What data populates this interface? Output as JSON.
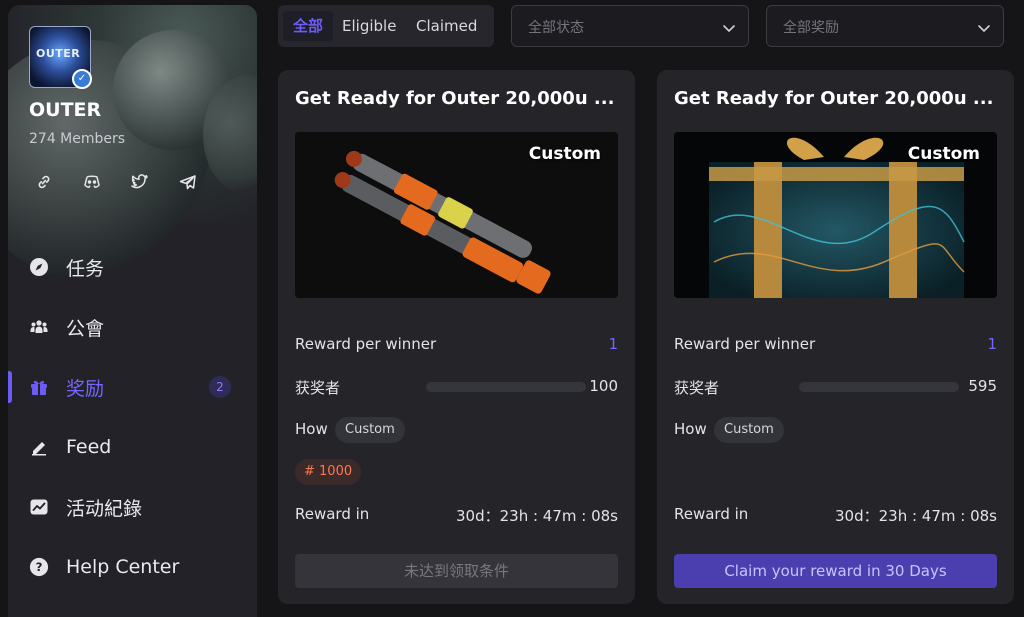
{
  "sidebar": {
    "brand": "OUTER",
    "logo_text": "OUTER",
    "members": "274 Members",
    "socials": [
      "link-icon",
      "discord-icon",
      "twitter-icon",
      "telegram-icon"
    ],
    "nav": [
      {
        "label": "任务",
        "icon": "compass-icon"
      },
      {
        "label": "公會",
        "icon": "community-icon"
      },
      {
        "label": "奖励",
        "icon": "gift-icon",
        "active": true,
        "badge": "2"
      },
      {
        "label": "Feed",
        "icon": "feed-icon"
      },
      {
        "label": "活动紀錄",
        "icon": "activity-chart-icon"
      },
      {
        "label": "Help Center",
        "icon": "help-icon"
      }
    ]
  },
  "filters": {
    "tabs": [
      "全部",
      "Eligible",
      "Claimed"
    ],
    "active_tab": "全部",
    "status_placeholder": "全部状态",
    "reward_placeholder": "全部奖励"
  },
  "cards": [
    {
      "title": "Get Ready for Outer 20,000u ...",
      "banner_tag": "Custom",
      "reward_per_winner_label": "Reward per winner",
      "reward_per_winner": "1",
      "winners_label": "获奖者",
      "winners": "100",
      "winners_progress": 0,
      "how_label": "How",
      "how_chip": "Custom",
      "points": "# 1000",
      "reward_in_label": "Reward in",
      "reward_in": "30d：23h : 47m : 08s",
      "button": "未达到领取条件"
    },
    {
      "title": "Get Ready for Outer 20,000u ...",
      "banner_tag": "Custom",
      "reward_per_winner_label": "Reward per winner",
      "reward_per_winner": "1",
      "winners_label": "获奖者",
      "winners": "595",
      "winners_progress": 0,
      "how_label": "How",
      "how_chip": "Custom",
      "reward_in_label": "Reward in",
      "reward_in": "30d：23h : 47m : 08s",
      "button": "Claim your reward in 30 Days"
    }
  ],
  "colors": {
    "accent": "#6c5cf6",
    "background": "#151518",
    "card": "#242429",
    "points": "#ff7650"
  }
}
